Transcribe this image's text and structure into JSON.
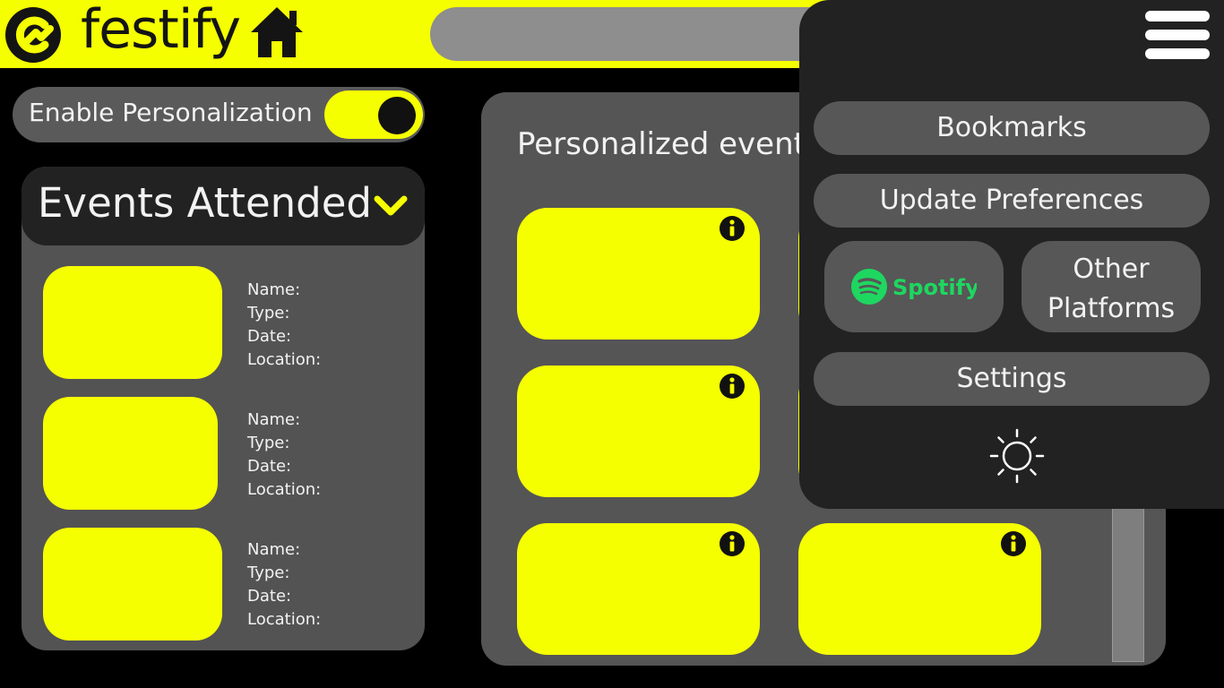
{
  "app": {
    "name": "festify"
  },
  "colors": {
    "accent": "#f5ff00",
    "background": "#000000",
    "panel": "#555555",
    "menu": "#222222",
    "spotify_green": "#1ed760"
  },
  "header": {
    "search": {
      "value": "",
      "placeholder": ""
    },
    "icons": [
      "festify-logo-icon",
      "home-icon"
    ]
  },
  "personalization": {
    "label": "Enable Personalization",
    "enabled": true
  },
  "attended": {
    "title": "Events Attended",
    "events": [
      {
        "name": "Name:",
        "type": "Type:",
        "date": "Date:",
        "location": "Location:"
      },
      {
        "name": "Name:",
        "type": "Type:",
        "date": "Date:",
        "location": "Location:"
      },
      {
        "name": "Name:",
        "type": "Type:",
        "date": "Date:",
        "location": "Location:"
      }
    ]
  },
  "personalized": {
    "title": "Personalized events"
  },
  "menu": {
    "bookmarks": "Bookmarks",
    "update_preferences": "Update Preferences",
    "spotify": "Spotify",
    "other_platforms": "Other Platforms",
    "settings": "Settings",
    "icons": [
      "hamburger-icon",
      "spotify-logo-icon",
      "sun-icon"
    ]
  }
}
